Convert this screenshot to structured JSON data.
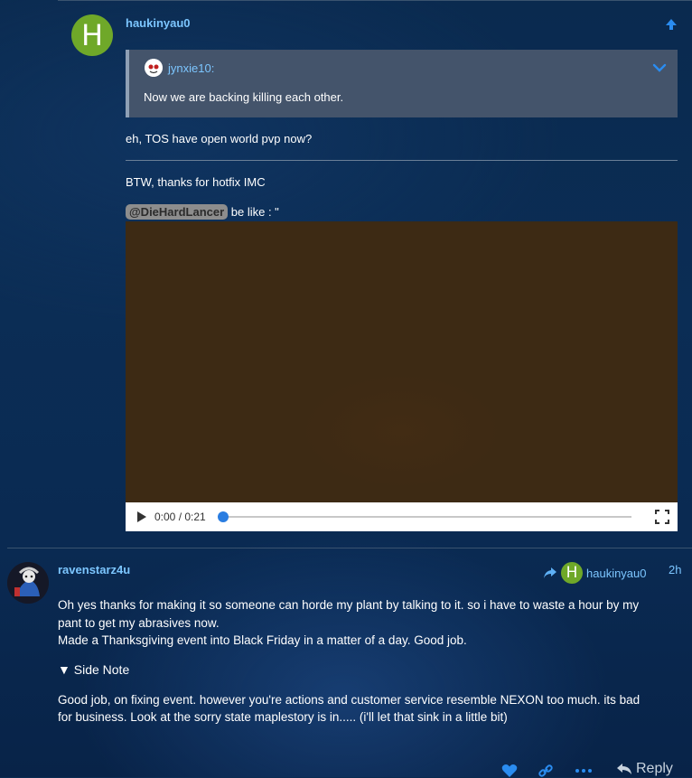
{
  "post1": {
    "avatar_letter": "H",
    "username": "haukinyau0",
    "quote": {
      "username": "jynxie10:",
      "text": "Now we are backing killing each other."
    },
    "line1": "eh, TOS have open world pvp now?",
    "line2": "BTW, thanks for hotfix IMC",
    "mention": "@DieHardLancer",
    "mention_suffix": " be like : \"",
    "video": {
      "time": "0:00 / 0:21",
      "progress": 0
    }
  },
  "post2": {
    "username": "ravenstarz4u",
    "reply_to": {
      "avatar_letter": "H",
      "username": "haukinyau0"
    },
    "time_ago": "2h",
    "para1_line1": "Oh yes thanks for making it so someone can horde my plant by talking to it. so i have to waste a hour by my",
    "para1_line2": "pant to get my abrasives now.",
    "para1_line3": "Made a Thanksgiving event into Black Friday in a matter of a day. Good job.",
    "details_summary": "▼ Side Note",
    "para2_line1": "Good job, on fixing event. however you're actions and customer service resemble NEXON too much. its bad",
    "para2_line2": "for business. Look at the sorry state maplestory is in..... (i'll let that sink in a little bit)",
    "actions": {
      "like_icon": "heart-icon",
      "link_icon": "link-icon",
      "more_icon": "ellipsis-icon",
      "reply_label": "Reply"
    }
  },
  "colors": {
    "link": "#7cc6ff",
    "avatar_green": "#6fa829",
    "quote_bg": "#44546b",
    "accent_blue": "#2a7de1"
  }
}
